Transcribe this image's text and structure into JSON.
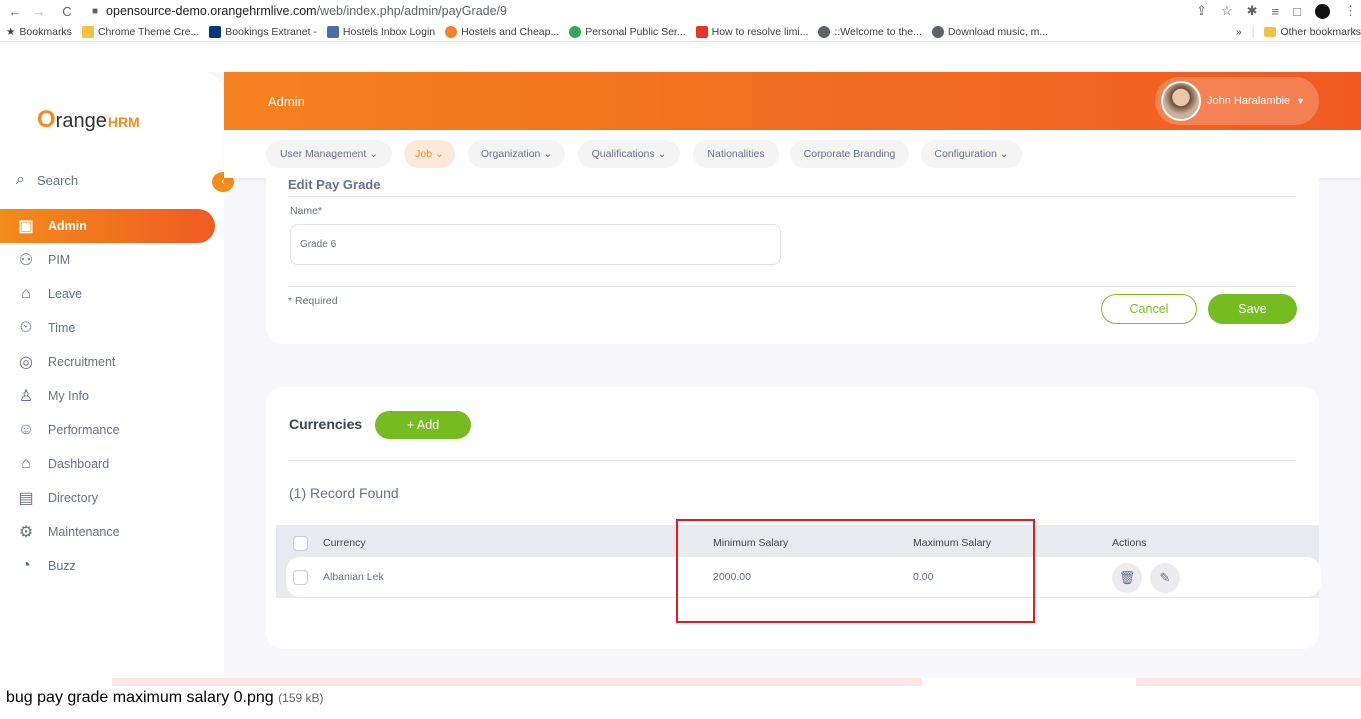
{
  "browser": {
    "url_domain": "opensource-demo.orangehrmlive.com",
    "url_path": "/web/index.php/admin/payGrade/9",
    "bookmarks": [
      "Bookmarks",
      "Chrome Theme Cre...",
      "Bookings Extranet -",
      "Hostels Inbox Login",
      "Hostels and Cheap...",
      "Personal Public Ser...",
      "How to resolve limi...",
      "::Welcome to the...",
      "Download music, m..."
    ],
    "overflow": "»",
    "other_bookmarks": "Other bookmarks"
  },
  "brand": {
    "logo_o": "O",
    "logo_text": "range",
    "logo_hrm": "HRM",
    "accent": "#f28c1a"
  },
  "sidebar": {
    "search_label": "Search",
    "items": [
      {
        "label": "Admin",
        "icon": "admin-icon"
      },
      {
        "label": "PIM",
        "icon": "pim-icon"
      },
      {
        "label": "Leave",
        "icon": "leave-icon"
      },
      {
        "label": "Time",
        "icon": "time-icon"
      },
      {
        "label": "Recruitment",
        "icon": "recruitment-icon"
      },
      {
        "label": "My Info",
        "icon": "my-info-icon"
      },
      {
        "label": "Performance",
        "icon": "performance-icon"
      },
      {
        "label": "Dashboard",
        "icon": "dashboard-icon"
      },
      {
        "label": "Directory",
        "icon": "directory-icon"
      },
      {
        "label": "Maintenance",
        "icon": "maintenance-icon"
      },
      {
        "label": "Buzz",
        "icon": "buzz-icon"
      }
    ]
  },
  "header": {
    "module": "Admin",
    "user_name": "John Haralambie"
  },
  "topnav": [
    "User Management",
    "Job",
    "Organization",
    "Qualifications",
    "Nationalities",
    "Corporate Branding",
    "Configuration"
  ],
  "form": {
    "title": "Edit Pay Grade",
    "name_label": "Name*",
    "name_value": "Grade 6",
    "required_note": "* Required",
    "cancel_label": "Cancel",
    "save_label": "Save"
  },
  "currencies": {
    "title": "Currencies",
    "add_label": "+ Add",
    "records": "(1) Record Found",
    "columns": [
      "Currency",
      "Minimum Salary",
      "Maximum Salary",
      "Actions"
    ],
    "rows": [
      {
        "currency": "Albanian Lek",
        "min": "2000.00",
        "max": "0.00"
      }
    ]
  },
  "caption": {
    "filename": "bug pay grade maximum salary 0.png",
    "size": "(159 kB)"
  }
}
